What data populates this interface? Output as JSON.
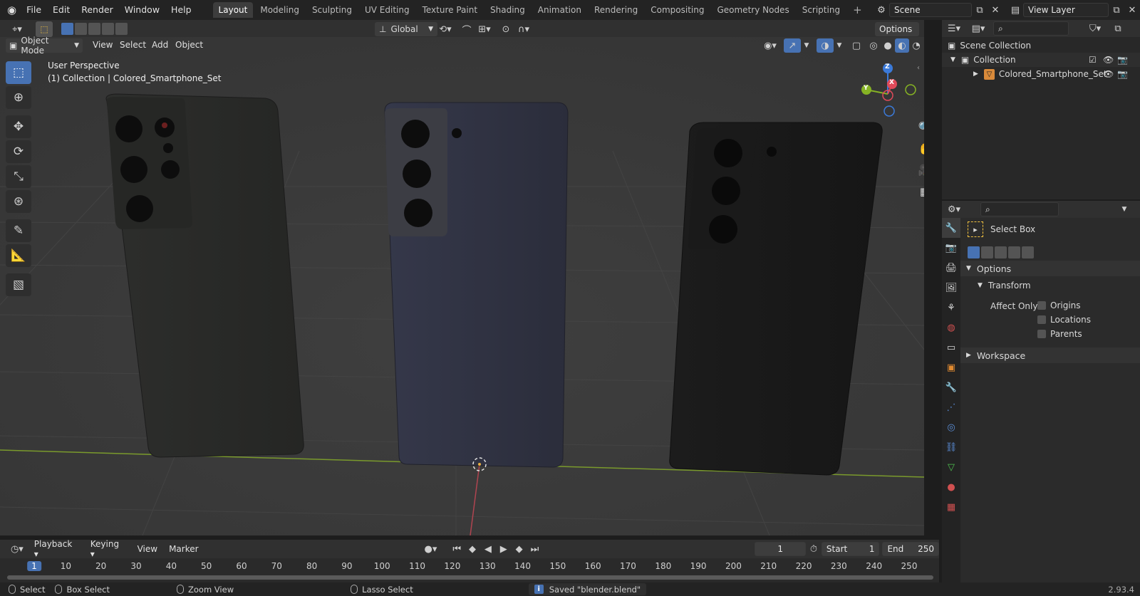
{
  "menu": [
    "File",
    "Edit",
    "Render",
    "Window",
    "Help"
  ],
  "workspaces": [
    "Layout",
    "Modeling",
    "Sculpting",
    "UV Editing",
    "Texture Paint",
    "Shading",
    "Animation",
    "Rendering",
    "Compositing",
    "Geometry Nodes",
    "Scripting"
  ],
  "active_workspace": "Layout",
  "scene": {
    "label": "Scene"
  },
  "view_layer": {
    "label": "View Layer"
  },
  "tool_header": {
    "orientation": "Global",
    "options": "Options"
  },
  "viewport_header": {
    "mode": "Object Mode",
    "menus": [
      "View",
      "Select",
      "Add",
      "Object"
    ]
  },
  "viewport": {
    "perspective": "User Perspective",
    "collection_info": "(1) Collection | Colored_Smartphone_Set"
  },
  "gizmo": {
    "z": "Z",
    "y": "Y",
    "x": "X"
  },
  "outliner": {
    "scene_collection": "Scene Collection",
    "collection": "Collection",
    "object": "Colored_Smartphone_Set"
  },
  "properties": {
    "tool_name": "Select Box",
    "options": "Options",
    "transform": "Transform",
    "affect_only": "Affect Only",
    "checkboxes": [
      "Origins",
      "Locations",
      "Parents"
    ],
    "workspace": "Workspace"
  },
  "timeline": {
    "menus": [
      "Playback",
      "Keying",
      "View",
      "Marker"
    ],
    "current_frame": "1",
    "start_label": "Start",
    "start": "1",
    "end_label": "End",
    "end": "250",
    "ticks": [
      "1",
      "10",
      "20",
      "30",
      "40",
      "50",
      "60",
      "70",
      "80",
      "90",
      "100",
      "110",
      "120",
      "130",
      "140",
      "150",
      "160",
      "170",
      "180",
      "190",
      "200",
      "210",
      "220",
      "230",
      "240",
      "250"
    ]
  },
  "statusbar": {
    "select": "Select",
    "box_select": "Box Select",
    "zoom_view": "Zoom View",
    "lasso_select": "Lasso Select",
    "message": "Saved \"blender.blend\"",
    "version": "2.93.4"
  },
  "colors": {
    "accent": "#4772b3",
    "x_axis": "#e04a5a",
    "y_axis": "#86b324",
    "z_axis": "#3b7ad9",
    "active_frame": "#4772b3"
  }
}
